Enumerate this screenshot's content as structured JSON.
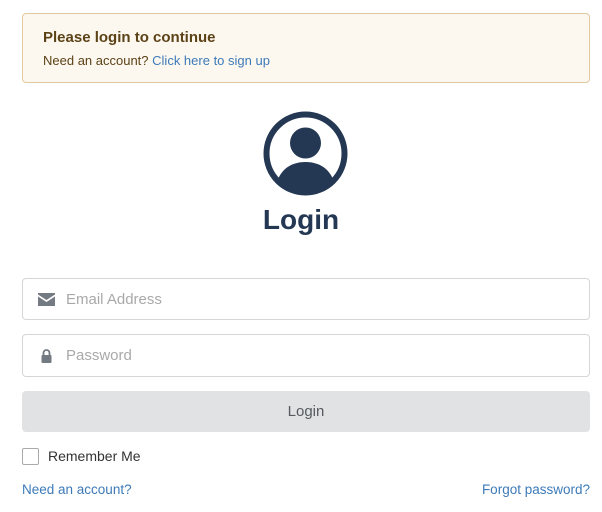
{
  "alert": {
    "title": "Please login to continue",
    "text": "Need an account?",
    "link": "Click here to sign up"
  },
  "avatar": {
    "icon": "user-circle-icon",
    "color": "#243854"
  },
  "form": {
    "title": "Login",
    "email": {
      "placeholder": "Email Address",
      "value": "",
      "icon": "envelope-icon"
    },
    "password": {
      "placeholder": "Password",
      "value": "",
      "icon": "lock-icon"
    },
    "submit_label": "Login",
    "remember_label": "Remember Me",
    "remember_checked": false
  },
  "footer": {
    "need_account": "Need an account?",
    "forgot_password": "Forgot password?"
  },
  "colors": {
    "accent_link": "#3d7ab8",
    "title": "#243854",
    "alert_bg": "#fdf8ef",
    "alert_border": "#e3c9a0",
    "button_bg": "#e1e2e3"
  }
}
